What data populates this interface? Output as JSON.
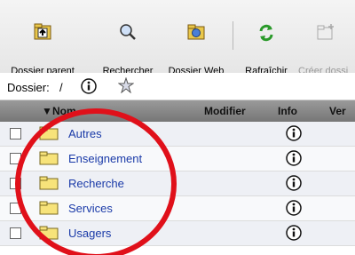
{
  "toolbar": {
    "dossier_parent": "Dossier parent",
    "rechercher": "Rechercher",
    "dossier_web": "Dossier Web",
    "rafraichir": "Rafraîchir",
    "creer_dossier": "Créer dossi"
  },
  "path": {
    "label": "Dossier:",
    "separator": "/"
  },
  "header": {
    "nom": "Nom",
    "modifier": "Modifier",
    "info": "Info",
    "ver": "Ver"
  },
  "rows": [
    {
      "name": "Autres"
    },
    {
      "name": "Enseignement"
    },
    {
      "name": "Recherche"
    },
    {
      "name": "Services"
    },
    {
      "name": "Usagers"
    }
  ],
  "colors": {
    "link": "#1a3aa8",
    "annotation_circle": "#e0101a",
    "folder": "#f7e37a"
  },
  "icons": [
    "folder-up-icon",
    "magnifier-icon",
    "web-folder-icon",
    "refresh-icon",
    "new-folder-icon",
    "info-icon",
    "star-icon",
    "folder-icon"
  ]
}
